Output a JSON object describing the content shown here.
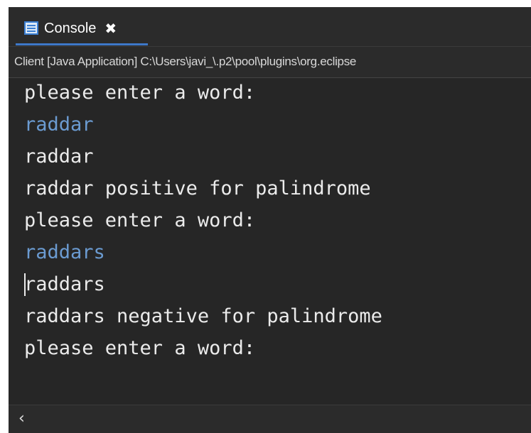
{
  "tab": {
    "label": "Console",
    "close_glyph": "✖",
    "icon": "console-icon"
  },
  "description": "Client [Java Application] C:\\Users\\javi_\\.p2\\pool\\plugins\\org.eclipse",
  "lines": [
    {
      "text": "please enter a word:",
      "kind": "output"
    },
    {
      "text": "raddar",
      "kind": "input"
    },
    {
      "text": "raddar",
      "kind": "output"
    },
    {
      "text": "raddar positive for palindrome",
      "kind": "output"
    },
    {
      "text": "please enter a word:",
      "kind": "output"
    },
    {
      "text": "raddars",
      "kind": "input"
    },
    {
      "text": "raddars",
      "kind": "output"
    },
    {
      "text": "raddars negative for palindrome",
      "kind": "output"
    },
    {
      "text": "please enter a word:",
      "kind": "output"
    }
  ],
  "scrollbar": {
    "left_arrow": "‹"
  },
  "colors": {
    "background": "#262626",
    "input_text": "#6b9bd1",
    "output_text": "#ebebeb",
    "tab_underline": "#3d78c9"
  }
}
